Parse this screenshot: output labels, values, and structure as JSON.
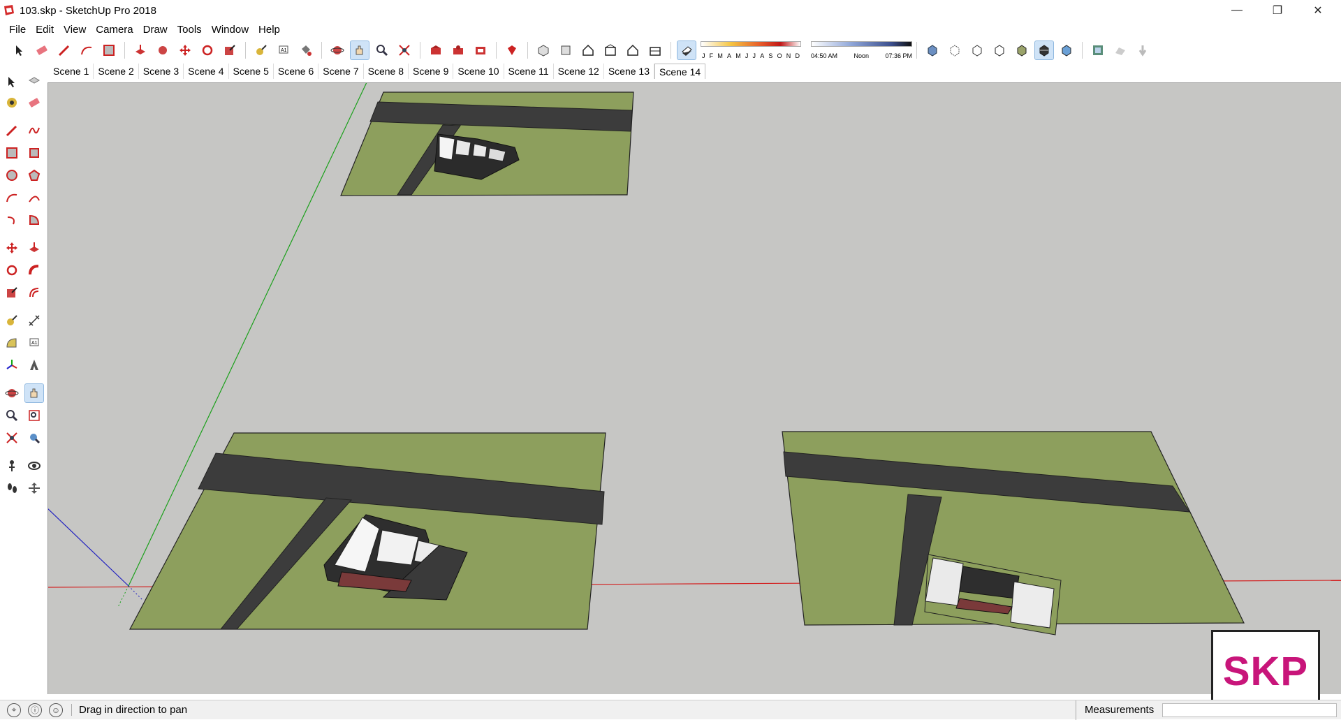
{
  "window": {
    "title": "103.skp - SketchUp Pro 2018",
    "minimize": "—",
    "restore": "❐",
    "close": "✕"
  },
  "menu": [
    "File",
    "Edit",
    "View",
    "Camera",
    "Draw",
    "Tools",
    "Window",
    "Help"
  ],
  "shadows": {
    "months": [
      "J",
      "F",
      "M",
      "A",
      "M",
      "J",
      "J",
      "A",
      "S",
      "O",
      "N",
      "D"
    ],
    "time_start": "04:50 AM",
    "time_mid": "Noon",
    "time_end": "07:36 PM"
  },
  "scenes": [
    "Scene 1",
    "Scene 2",
    "Scene 3",
    "Scene 4",
    "Scene 5",
    "Scene 6",
    "Scene 7",
    "Scene 8",
    "Scene 9",
    "Scene 10",
    "Scene 11",
    "Scene 12",
    "Scene 13",
    "Scene 14"
  ],
  "active_scene": "Scene 14",
  "status": {
    "hint": "Drag in direction to pan",
    "measurements_label": "Measurements",
    "measurements_value": ""
  },
  "logo": {
    "text": "SKP"
  },
  "colors": {
    "grass": "#8d9f5d",
    "road": "#3c3c3c",
    "ground": "#c6c6c4",
    "logo": "#c8157a",
    "axis_red": "#d32020",
    "axis_green": "#1aa01a",
    "axis_blue": "#2020c0"
  }
}
